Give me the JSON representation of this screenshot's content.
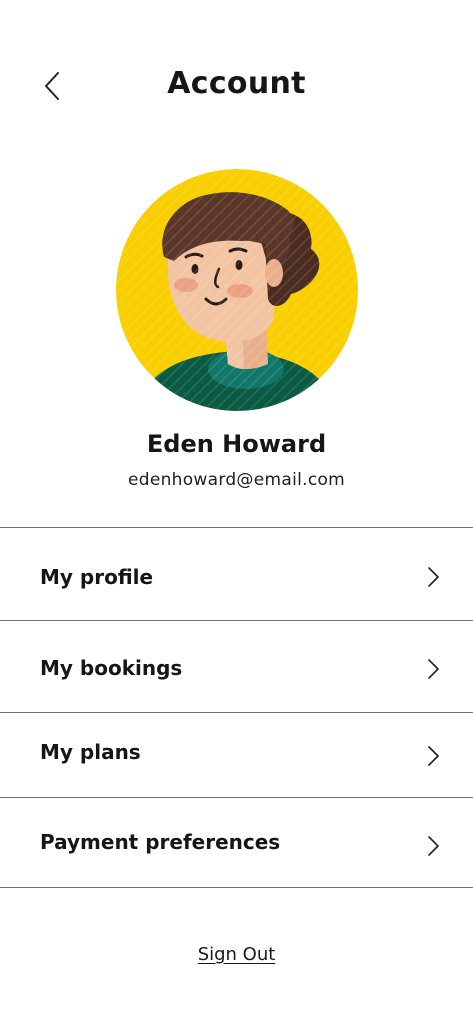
{
  "header": {
    "title": "Account",
    "back_icon": "chevron-left-icon"
  },
  "profile": {
    "name": "Eden Howard",
    "email": "edenhoward@email.com",
    "avatar_icon": "user-avatar-illustration",
    "colors": {
      "avatar_bg": "#F9CF00",
      "hair": "#5A3728",
      "skin": "#F2C4A2",
      "shirt": "#0B5A43"
    }
  },
  "menu": {
    "items": [
      {
        "label": "My profile",
        "icon": "chevron-right-icon"
      },
      {
        "label": "My bookings",
        "icon": "chevron-right-icon"
      },
      {
        "label": "My plans",
        "icon": "chevron-right-icon"
      },
      {
        "label": "Payment preferences",
        "icon": "chevron-right-icon"
      }
    ]
  },
  "footer": {
    "sign_out_label": "Sign Out"
  }
}
